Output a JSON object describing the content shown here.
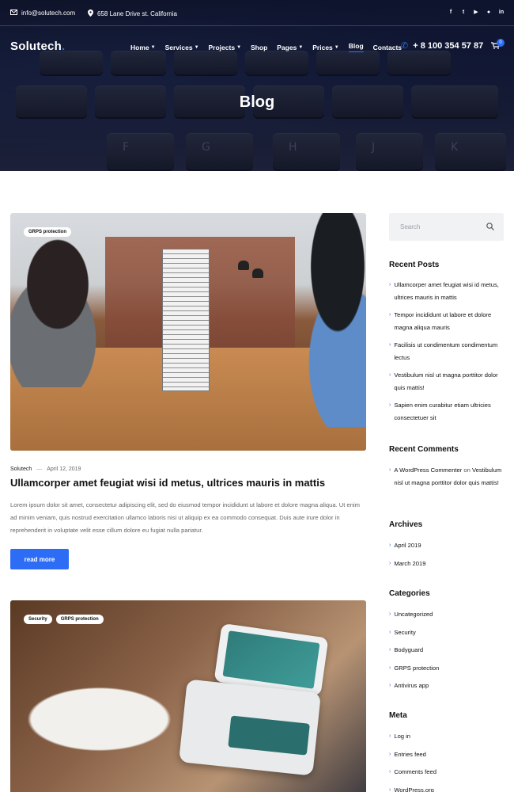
{
  "topbar": {
    "email": "info@solutech.com",
    "address": "658 Lane Drive st. California",
    "socials": [
      "facebook-icon",
      "twitter-icon",
      "youtube-icon",
      "github-icon",
      "linkedin-icon"
    ]
  },
  "nav": {
    "logo": "Solutech",
    "logo_dot": ".",
    "items": [
      {
        "label": "Home",
        "dropdown": true
      },
      {
        "label": "Services",
        "dropdown": true
      },
      {
        "label": "Projects",
        "dropdown": true
      },
      {
        "label": "Shop",
        "dropdown": false
      },
      {
        "label": "Pages",
        "dropdown": true
      },
      {
        "label": "Prices",
        "dropdown": true
      },
      {
        "label": "Blog",
        "dropdown": false,
        "active": true
      },
      {
        "label": "Contacts",
        "dropdown": false
      }
    ],
    "phone": "+ 8 100 354 57 87",
    "cart_count": "0"
  },
  "hero": {
    "title": "Blog",
    "keys": [
      "F",
      "G",
      "H",
      "J",
      "K"
    ]
  },
  "posts": [
    {
      "tags": [
        "GRPS protection"
      ],
      "author": "Solutech",
      "separator": "—",
      "date": "April 12, 2019",
      "title": "Ullamcorper amet feugiat wisi id metus, ultrices mauris in mattis",
      "excerpt": "Lorem ipsum dolor sit amet, consectetur adipiscing elit, sed do eiusmod tempor incididunt ut labore et dolore magna aliqua. Ut enim ad minim veniam, quis nostrud exercitation ullamco laboris nisi ut aliquip ex ea commodo consequat. Duis aute irure dolor in reprehenderit in voluptate velit esse cillum dolore eu fugiat nulla pariatur.",
      "button": "read more"
    },
    {
      "tags": [
        "Security",
        "GRPS protection"
      ]
    }
  ],
  "sidebar": {
    "search_placeholder": "Search",
    "recent_posts": {
      "title": "Recent Posts",
      "items": [
        "Ullamcorper amet feugiat wisi id metus, ultrices mauris in mattis",
        "Tempor incididunt ut labore et dolore magna aliqua mauris",
        "Facilisis ut condimentum condimentum lectus",
        "Vestibulum nisl ut magna porttitor dolor quis mattis!",
        "Sapien enim curabitur etiam ultricies consectetuer sit"
      ]
    },
    "recent_comments": {
      "title": "Recent Comments",
      "author": "A WordPress Commenter",
      "on": "on",
      "post": "Vestibulum nisl ut magna porttitor dolor quis mattis!"
    },
    "archives": {
      "title": "Archives",
      "items": [
        "April 2019",
        "March 2019"
      ]
    },
    "categories": {
      "title": "Categories",
      "items": [
        "Uncategorized",
        "Security",
        "Bodyguard",
        "GRPS protection",
        "Antivirus app"
      ]
    },
    "meta": {
      "title": "Meta",
      "items": [
        "Log in",
        "Entries feed",
        "Comments feed",
        "WordPress.org"
      ]
    }
  },
  "colors": {
    "accent": "#2d6df6",
    "hero_bg": "#1b2240"
  }
}
